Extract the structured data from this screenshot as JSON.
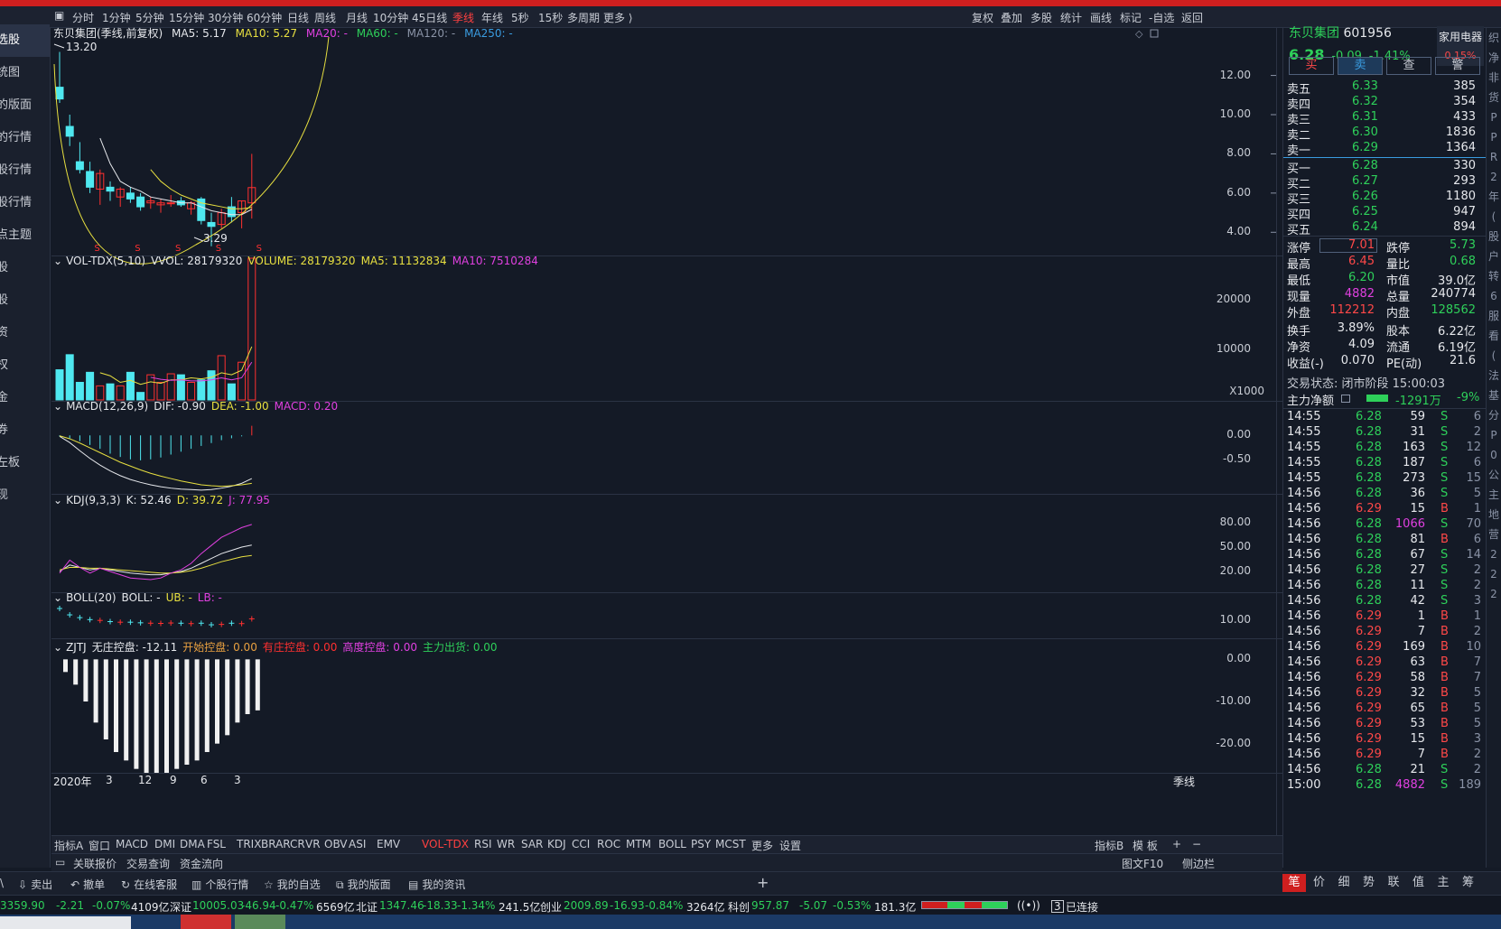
{
  "toolbar": {
    "periods": [
      "分时",
      "1分钟",
      "5分钟",
      "15分钟",
      "30分钟",
      "60分钟",
      "日线",
      "周线",
      "月线",
      "10分钟",
      "45日线",
      "季线",
      "年线",
      "5秒",
      "15秒",
      "多周期",
      "更多 ⟩"
    ],
    "active_period": "季线",
    "right_tools": [
      "复权",
      "叠加",
      "多股",
      "统计",
      "画线",
      "标记",
      "-自选",
      "返回"
    ]
  },
  "leftnav": {
    "items": [
      "选股",
      "统图",
      "的版面",
      "的行情",
      "股行情",
      "股行情",
      "点主题",
      "股",
      "股",
      "资",
      "权",
      "金",
      "券",
      "左板",
      "现"
    ]
  },
  "main": {
    "legend": {
      "name": "东贝集团(季线,前复权)",
      "ma5": "MA5: 5.17",
      "ma10": "MA10: 5.27",
      "ma20": "MA20: -",
      "ma60": "MA60: -",
      "ma120": "MA120: -",
      "ma250": "MA250: -"
    },
    "high_label": "13.20",
    "low_label": "3.29",
    "yticks": [
      "12.00",
      "10.00",
      "8.00",
      "6.00",
      "4.00"
    ]
  },
  "volume": {
    "legend": {
      "name": "VOL-TDX(5,10)",
      "vvol": "VVOL: 28179320",
      "volume": "VOLUME: 28179320",
      "ma5": "MA5: 11132834",
      "ma10": "MA10: 7510284"
    },
    "yticks": [
      "20000",
      "10000"
    ],
    "unit": "X1000"
  },
  "macd": {
    "legend": {
      "name": "MACD(12,26,9)",
      "dif": "DIF: -0.90",
      "dea": "DEA: -1.00",
      "macd": "MACD: 0.20"
    },
    "yticks": [
      "0.00",
      "-0.50"
    ]
  },
  "kdj": {
    "legend": {
      "name": "KDJ(9,3,3)",
      "k": "K: 52.46",
      "d": "D: 39.72",
      "j": "J: 77.95"
    },
    "yticks": [
      "80.00",
      "50.00",
      "20.00"
    ]
  },
  "boll": {
    "legend": {
      "name": "BOLL(20)",
      "boll": "BOLL: -",
      "ub": "UB: -",
      "lb": "LB: -"
    },
    "yticks": [
      "10.00"
    ]
  },
  "zjtj": {
    "legend": {
      "name": "ZJTJ",
      "wzkp": "无庄控盘: -12.11",
      "ksk": "开始控盘: 0.00",
      "yzk": "有庄控盘: 0.00",
      "gdk": "高度控盘: 0.00",
      "zlch": "主力出货: 0.00"
    },
    "yticks": [
      "0.00",
      "-10.00",
      "-20.00"
    ]
  },
  "xaxis": {
    "labels": [
      "2020年",
      "3",
      "12",
      "9",
      "6",
      "3"
    ],
    "period": "季线"
  },
  "indicator_tabs": [
    "指标A",
    "窗口",
    "MACD",
    "DMI",
    "DMA",
    "FSL",
    "TRIX",
    "BRAR",
    "CR",
    "VR",
    "OBV",
    "ASI",
    "EMV",
    "VOL-TDX",
    "RSI",
    "WR",
    "SAR",
    "KDJ",
    "CCI",
    "ROC",
    "MTM",
    "BOLL",
    "PSY",
    "MCST",
    "更多",
    "设置"
  ],
  "active_indicator": "VOL-TDX",
  "indicator_right": [
    "指标B",
    "模 板",
    "+",
    "−"
  ],
  "subtabs": [
    "关联报价",
    "交易查询",
    "资金流向"
  ],
  "subtabs_right": [
    "图文F10",
    "侧边栏"
  ],
  "quote": {
    "name": "东贝集团",
    "code": "601956",
    "sector": "家用电器",
    "sector_pct": "0.15%",
    "price": "6.28",
    "change": "-0.09",
    "pct": "-1.41%",
    "buttons": [
      "买",
      "卖",
      "查",
      "警"
    ],
    "sell": [
      {
        "l": "卖五",
        "p": "6.33",
        "v": "385"
      },
      {
        "l": "卖四",
        "p": "6.32",
        "v": "354"
      },
      {
        "l": "卖三",
        "p": "6.31",
        "v": "433"
      },
      {
        "l": "卖二",
        "p": "6.30",
        "v": "1836"
      },
      {
        "l": "卖一",
        "p": "6.29",
        "v": "1364"
      }
    ],
    "buy": [
      {
        "l": "买一",
        "p": "6.28",
        "v": "330"
      },
      {
        "l": "买二",
        "p": "6.27",
        "v": "293"
      },
      {
        "l": "买三",
        "p": "6.26",
        "v": "1180"
      },
      {
        "l": "买四",
        "p": "6.25",
        "v": "947"
      },
      {
        "l": "买五",
        "p": "6.24",
        "v": "894"
      }
    ],
    "stats": [
      {
        "a": "涨停",
        "av": "7.01",
        "ac": "red",
        "b": "跌停",
        "bv": "5.73",
        "bc": "green"
      },
      {
        "a": "最高",
        "av": "6.45",
        "ac": "red",
        "b": "量比",
        "bv": "0.68",
        "bc": "green"
      },
      {
        "a": "最低",
        "av": "6.20",
        "ac": "green",
        "b": "市值",
        "bv": "39.0亿",
        "bc": "white"
      },
      {
        "a": "现量",
        "av": "4882",
        "ac": "mag",
        "b": "总量",
        "bv": "240774",
        "bc": "white"
      },
      {
        "a": "外盘",
        "av": "112212",
        "ac": "red",
        "b": "内盘",
        "bv": "128562",
        "bc": "green"
      },
      {
        "a": "换手",
        "av": "3.89%",
        "ac": "white",
        "b": "股本",
        "bv": "6.22亿",
        "bc": "white"
      },
      {
        "a": "净资",
        "av": "4.09",
        "ac": "white",
        "b": "流通",
        "bv": "6.19亿",
        "bc": "white"
      },
      {
        "a": "收益(-)",
        "av": "0.070",
        "ac": "white",
        "b": "PE(动)",
        "bv": "21.6",
        "bc": "white"
      }
    ],
    "trade_status": "交易状态: 闭市阶段 15:00:03",
    "main_flow_label": "主力净额",
    "main_flow_value": "-1291万",
    "main_flow_pct": "-9%"
  },
  "ticks": [
    [
      "14:55",
      "6.28",
      "59",
      "S",
      "6"
    ],
    [
      "14:55",
      "6.28",
      "31",
      "S",
      "2"
    ],
    [
      "14:55",
      "6.28",
      "163",
      "S",
      "12"
    ],
    [
      "14:55",
      "6.28",
      "187",
      "S",
      "6"
    ],
    [
      "14:55",
      "6.28",
      "273",
      "S",
      "15"
    ],
    [
      "14:56",
      "6.28",
      "36",
      "S",
      "5"
    ],
    [
      "14:56",
      "6.29",
      "15",
      "B",
      "1"
    ],
    [
      "14:56",
      "6.28",
      "1066",
      "S",
      "70"
    ],
    [
      "14:56",
      "6.28",
      "81",
      "B",
      "6"
    ],
    [
      "14:56",
      "6.28",
      "67",
      "S",
      "14"
    ],
    [
      "14:56",
      "6.28",
      "27",
      "S",
      "2"
    ],
    [
      "14:56",
      "6.28",
      "11",
      "S",
      "2"
    ],
    [
      "14:56",
      "6.28",
      "42",
      "S",
      "3"
    ],
    [
      "14:56",
      "6.29",
      "1",
      "B",
      "1"
    ],
    [
      "14:56",
      "6.29",
      "7",
      "B",
      "2"
    ],
    [
      "14:56",
      "6.29",
      "169",
      "B",
      "10"
    ],
    [
      "14:56",
      "6.29",
      "63",
      "B",
      "7"
    ],
    [
      "14:56",
      "6.29",
      "58",
      "B",
      "7"
    ],
    [
      "14:56",
      "6.29",
      "32",
      "B",
      "5"
    ],
    [
      "14:56",
      "6.29",
      "65",
      "B",
      "5"
    ],
    [
      "14:56",
      "6.29",
      "53",
      "B",
      "5"
    ],
    [
      "14:56",
      "6.29",
      "15",
      "B",
      "3"
    ],
    [
      "14:56",
      "6.29",
      "7",
      "B",
      "2"
    ],
    [
      "14:56",
      "6.28",
      "21",
      "S",
      "2"
    ],
    [
      "15:00",
      "6.28",
      "4882",
      "S",
      "189"
    ]
  ],
  "quickbar": [
    "卖出",
    "撤单",
    "在线客服",
    "个股行情",
    "我的自选",
    "我的版面",
    "我的资讯"
  ],
  "right_tabs": [
    "笔",
    "价",
    "细",
    "势",
    "联",
    "值",
    "主",
    "筹"
  ],
  "edge_chars": [
    "织",
    "净",
    "非",
    "货",
    "P",
    "P",
    "R",
    "2",
    "年",
    "(",
    "股",
    "户",
    "转",
    "6",
    "服",
    "看",
    "(",
    "法",
    "基",
    "分",
    "P",
    "0",
    "公",
    "主",
    "地",
    "营",
    "2",
    "2",
    "2"
  ],
  "status": {
    "sh": "3359.90",
    "sh_chg": "-2.21",
    "sh_pct": "-0.07%",
    "sh_amt": "4109亿",
    "sz_label": "深证",
    "sz": "10005.03",
    "sz_chg": "-46.94",
    "sz_pct": "-0.47%",
    "sz_amt": "6569亿",
    "bz_label": "北证",
    "bz": "1347.46",
    "bz_chg": "-18.33",
    "bz_pct": "-1.34%",
    "bz_amt": "241.5亿",
    "cy_label": "创业",
    "cy": "2009.89",
    "cy_chg": "-16.93",
    "cy_pct": "-0.84%",
    "cy_amt": "3264亿",
    "kc_label": "科创",
    "kc": "957.87",
    "kc_chg": "-5.07",
    "kc_pct": "-0.53%",
    "kc_amt": "181.3亿",
    "conn_num": "3",
    "conn": "已连接"
  },
  "chart_data": {
    "type": "candlestick",
    "ylim": [
      3.0,
      13.5
    ],
    "candles": [
      {
        "o": 11.4,
        "h": 13.2,
        "l": 10.6,
        "c": 10.8
      },
      {
        "o": 9.4,
        "h": 10.0,
        "l": 8.4,
        "c": 8.9
      },
      {
        "o": 7.6,
        "h": 8.6,
        "l": 7.0,
        "c": 7.2
      },
      {
        "o": 7.1,
        "h": 7.6,
        "l": 6.0,
        "c": 6.3
      },
      {
        "o": 6.2,
        "h": 7.2,
        "l": 5.4,
        "c": 7.0
      },
      {
        "o": 6.3,
        "h": 6.6,
        "l": 5.6,
        "c": 6.1
      },
      {
        "o": 5.8,
        "h": 6.3,
        "l": 5.3,
        "c": 6.2
      },
      {
        "o": 6.0,
        "h": 6.3,
        "l": 5.5,
        "c": 5.7
      },
      {
        "o": 5.8,
        "h": 6.0,
        "l": 5.1,
        "c": 5.3
      },
      {
        "o": 5.5,
        "h": 5.8,
        "l": 5.2,
        "c": 5.6
      },
      {
        "o": 5.4,
        "h": 5.7,
        "l": 5.0,
        "c": 5.5
      },
      {
        "o": 5.5,
        "h": 5.9,
        "l": 5.3,
        "c": 5.5
      },
      {
        "o": 5.6,
        "h": 5.8,
        "l": 5.3,
        "c": 5.4
      },
      {
        "o": 5.2,
        "h": 5.6,
        "l": 4.9,
        "c": 5.5
      },
      {
        "o": 5.7,
        "h": 5.8,
        "l": 4.4,
        "c": 4.6
      },
      {
        "o": 4.5,
        "h": 5.0,
        "l": 3.29,
        "c": 4.3
      },
      {
        "o": 4.4,
        "h": 5.2,
        "l": 4.2,
        "c": 5.0
      },
      {
        "o": 5.3,
        "h": 5.8,
        "l": 4.5,
        "c": 4.8
      },
      {
        "o": 5.0,
        "h": 5.6,
        "l": 4.2,
        "c": 5.6
      },
      {
        "o": 5.5,
        "h": 8.0,
        "l": 4.7,
        "c": 6.28
      }
    ],
    "ma5": [
      null,
      null,
      null,
      null,
      8.8,
      7.5,
      6.6,
      6.3,
      6.1,
      5.8,
      5.7,
      5.6,
      5.5,
      5.5,
      5.3,
      5.1,
      5.0,
      4.9,
      4.9,
      5.17
    ],
    "ma10": [
      null,
      null,
      null,
      null,
      null,
      null,
      null,
      null,
      null,
      7.2,
      6.6,
      6.2,
      5.9,
      5.7,
      5.5,
      5.4,
      5.3,
      5.2,
      5.2,
      5.27
    ],
    "volume_ylim": [
      0,
      28179
    ],
    "volume": [
      6000,
      9000,
      3500,
      5500,
      2800,
      3200,
      2800,
      5500,
      1500,
      5000,
      3500,
      5200,
      5000,
      3500,
      4000,
      5800,
      8800,
      3200,
      7500,
      28179
    ],
    "vol_ma5": [
      null,
      null,
      null,
      null,
      5400,
      4800,
      3500,
      3900,
      3100,
      3600,
      3300,
      4000,
      4000,
      4400,
      4200,
      4500,
      5400,
      5000,
      5900,
      10600
    ],
    "vol_ma10": [
      null,
      null,
      null,
      null,
      null,
      null,
      null,
      null,
      null,
      4500,
      4100,
      3900,
      4000,
      3800,
      3800,
      4000,
      4400,
      4000,
      4400,
      7510
    ],
    "macd_ylim": [
      -1.2,
      0.4
    ],
    "macd_hist": [
      -0.02,
      -0.06,
      -0.12,
      -0.2,
      -0.28,
      -0.38,
      -0.45,
      -0.5,
      -0.52,
      -0.5,
      -0.46,
      -0.4,
      -0.34,
      -0.28,
      -0.22,
      -0.16,
      -0.1,
      -0.06,
      -0.02,
      0.2
    ],
    "dif": [
      -0.02,
      -0.15,
      -0.32,
      -0.48,
      -0.62,
      -0.74,
      -0.84,
      -0.92,
      -0.98,
      -1.03,
      -1.07,
      -1.1,
      -1.12,
      -1.13,
      -1.14,
      -1.13,
      -1.1,
      -1.06,
      -1.0,
      -0.9
    ],
    "dea": [
      -0.01,
      -0.07,
      -0.16,
      -0.26,
      -0.36,
      -0.46,
      -0.56,
      -0.64,
      -0.72,
      -0.79,
      -0.85,
      -0.9,
      -0.95,
      -0.99,
      -1.03,
      -1.05,
      -1.06,
      -1.05,
      -1.03,
      -1.0
    ],
    "kdj_ylim": [
      0,
      100
    ],
    "k": [
      20,
      28,
      25,
      22,
      24,
      22,
      20,
      18,
      17,
      16,
      16,
      18,
      20,
      24,
      30,
      36,
      42,
      46,
      50,
      52.46
    ],
    "d": [
      22,
      25,
      25,
      24,
      24,
      23,
      22,
      21,
      20,
      19,
      18,
      18,
      19,
      21,
      24,
      28,
      32,
      35,
      38,
      39.72
    ],
    "j": [
      18,
      34,
      25,
      18,
      24,
      20,
      16,
      12,
      11,
      10,
      12,
      18,
      22,
      30,
      42,
      52,
      62,
      68,
      74,
      77.95
    ],
    "zjtj_ylim": [
      -28,
      2
    ],
    "zjtj": [
      -3,
      -6,
      -10,
      -15,
      -19,
      -22,
      -24,
      -26,
      -27,
      -27,
      -27,
      -26,
      -25,
      -24,
      -22,
      -20,
      -18,
      -15,
      -13,
      -12.11
    ]
  }
}
